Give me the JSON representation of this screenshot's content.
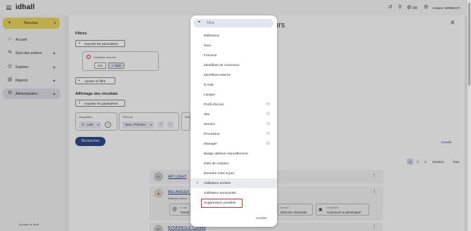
{
  "header": {
    "logo": "idhall",
    "language": "FR",
    "user_name": "Antoine HERBIVOT"
  },
  "sidebar": {
    "new_label": "Nouveau",
    "items": [
      {
        "label": "Accueil",
        "icon": "home-icon",
        "chevron": false
      },
      {
        "label": "Suivi des actions",
        "icon": "tracking-icon",
        "chevron": true
      },
      {
        "label": "Explorer",
        "icon": "compass-icon",
        "chevron": true
      },
      {
        "label": "Reports",
        "icon": "report-icon",
        "chevron": true
      },
      {
        "label": "Administration",
        "icon": "gear-icon",
        "chevron": true,
        "active": true
      }
    ],
    "about": "À propos de Idhall"
  },
  "main": {
    "title_fragment": "urs",
    "filters_heading": "Filtres",
    "import_label": "Importer les paramètres",
    "filter_label": "Utilisateur archivé",
    "oui_label": "Oui",
    "non_label": "Non",
    "add_filter_label": "Ajouter un filtre",
    "display_heading": "Affichage des résultats",
    "import_label_2": "Importer les paramètres",
    "disposition_label": "Disposition",
    "disposition_value": "Liste",
    "sort_label": "Trier par",
    "sort_value": "Nom / Prénom",
    "third_group_label": "Réc",
    "search_label": "Rechercher",
    "cancel_label": "Annuler",
    "pager": {
      "pages": [
        "1",
        "2",
        "3"
      ],
      "next": "Suivant",
      "all": "Tous"
    }
  },
  "results": [
    {
      "initials": "AL",
      "name": "API LIGHT"
    },
    {
      "initials": "",
      "name": "BELANGER T",
      "sub": "Référent Sécur",
      "info": [
        {
          "k": "E-mail",
          "v": "Tom@"
        },
        {
          "k": "Service",
          "v": "Direction Générale"
        },
        {
          "k": "Processus",
          "v": "Concevoir et développer"
        }
      ]
    },
    {
      "initials": "BC",
      "name": "BONNINGUE Cynthia"
    }
  ],
  "dropdown": {
    "search_placeholder": "Filtre",
    "items": [
      {
        "label": "Référence",
        "group": false,
        "checked": false
      },
      {
        "label": "Nom",
        "group": false,
        "checked": false
      },
      {
        "label": "Fonction",
        "group": false,
        "checked": false
      },
      {
        "label": "Identifiant de connexion",
        "group": false,
        "checked": false
      },
      {
        "label": "Identifiant externe",
        "group": false,
        "checked": false
      },
      {
        "label": "E-mail",
        "group": false,
        "checked": false
      },
      {
        "label": "Langue",
        "group": false,
        "checked": false
      },
      {
        "label": "Profil d'accès",
        "group": true,
        "checked": false
      },
      {
        "label": "Site",
        "group": true,
        "checked": false
      },
      {
        "label": "Service",
        "group": true,
        "checked": false
      },
      {
        "label": "Processus",
        "group": true,
        "checked": false
      },
      {
        "label": "Manager",
        "group": true,
        "checked": false
      },
      {
        "label": "Badge attribué manuellement",
        "group": false,
        "checked": false
      },
      {
        "label": "Date de création",
        "group": false,
        "checked": false
      },
      {
        "label": "Dernière mise à jour",
        "group": false,
        "checked": false
      },
      {
        "label": "Utilisateur archivé",
        "group": false,
        "checked": true
      },
      {
        "label": "Utilisateur anonymisé",
        "group": false,
        "checked": false
      },
      {
        "label": "Suppression possible",
        "group": false,
        "checked": false,
        "highlighted": true
      }
    ],
    "cancel_label": "Annuler"
  }
}
